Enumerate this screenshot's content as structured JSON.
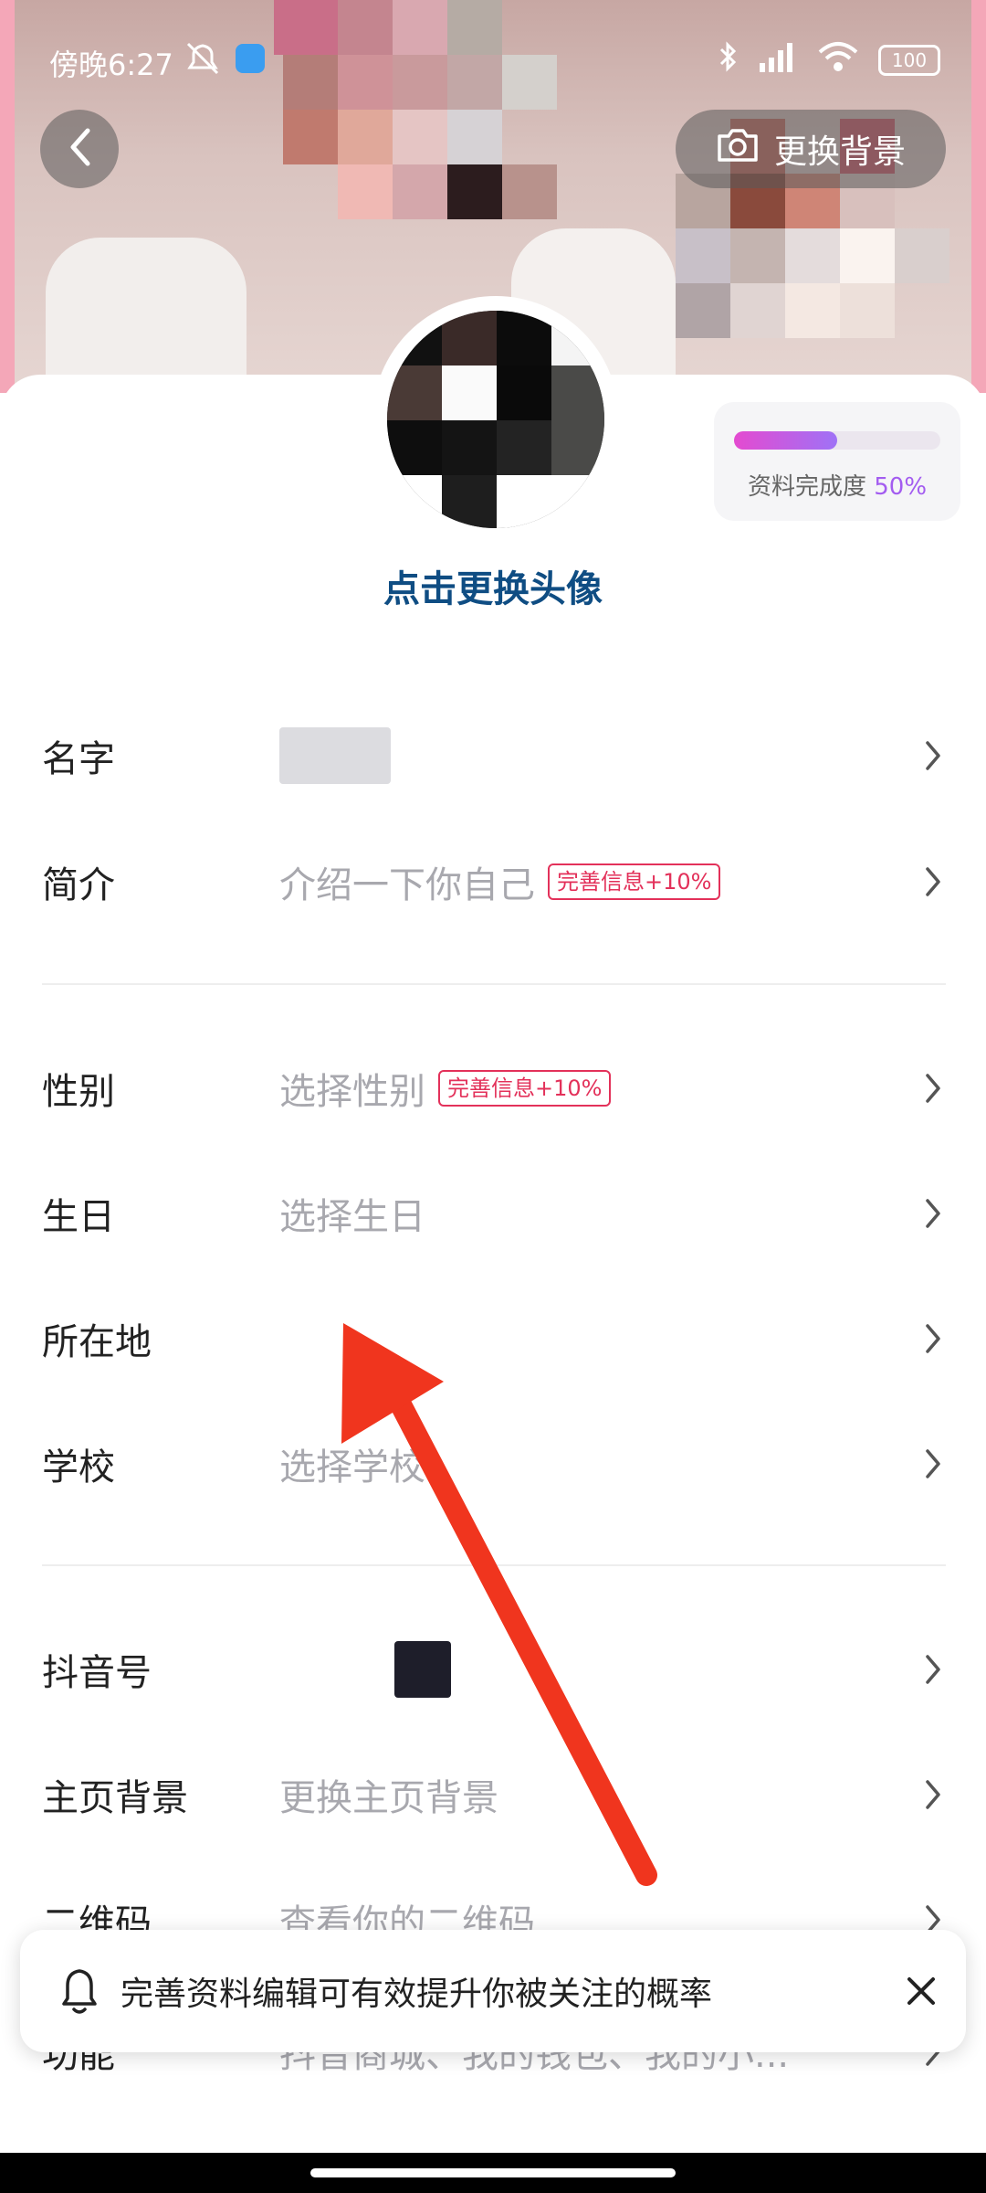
{
  "status_bar": {
    "time": "傍晚6:27",
    "battery": "100"
  },
  "header": {
    "change_background_label": "更换背景"
  },
  "avatar": {
    "caption": "点击更换头像"
  },
  "completion": {
    "label": "资料完成度",
    "percent_text": "50%",
    "percent_value": 0.5
  },
  "rows": {
    "name": {
      "label": "名字",
      "value": ""
    },
    "intro": {
      "label": "简介",
      "value": "介绍一下你自己",
      "badge": "完善信息+10%"
    },
    "gender": {
      "label": "性别",
      "value": "选择性别",
      "badge": "完善信息+10%"
    },
    "birthday": {
      "label": "生日",
      "value": "选择生日"
    },
    "location": {
      "label": "所在地",
      "value": ""
    },
    "school": {
      "label": "学校",
      "value": "选择学校"
    },
    "douyin_id": {
      "label": "抖音号",
      "value": ""
    },
    "home_bg": {
      "label": "主页背景",
      "value": "更换主页背景"
    },
    "qrcode": {
      "label": "二维码",
      "value": "查看你的二维码"
    },
    "features": {
      "label": "功能",
      "value": "抖音商城、我的钱包、我的小..."
    }
  },
  "toast": {
    "message": "完善资料编辑可有效提升你被关注的概率"
  },
  "colors": {
    "accent_pink": "#e3315a",
    "accent_purple": "#a35cf0",
    "annotation_arrow": "#f0351e"
  }
}
